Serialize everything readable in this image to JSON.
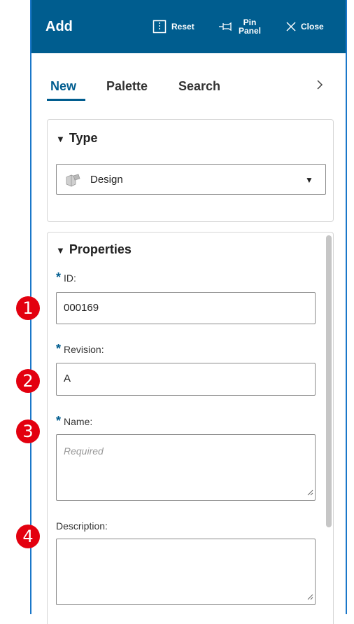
{
  "header": {
    "title": "Add",
    "reset_label": "Reset",
    "pin_label_line1": "Pin",
    "pin_label_line2": "Panel",
    "close_label": "Close",
    "background_color": "#005d8f"
  },
  "tabs": [
    {
      "label": "New",
      "active": true
    },
    {
      "label": "Palette",
      "active": false
    },
    {
      "label": "Search",
      "active": false
    }
  ],
  "tabs_more_icon": "chevron-right-icon",
  "type_section": {
    "heading": "Type",
    "selected_value": "Design",
    "icon": "design-item-icon"
  },
  "properties_section": {
    "heading": "Properties",
    "fields": [
      {
        "label": "ID:",
        "required": true,
        "value": "000169",
        "placeholder": ""
      },
      {
        "label": "Revision:",
        "required": true,
        "value": "A",
        "placeholder": ""
      },
      {
        "label": "Name:",
        "required": true,
        "value": "",
        "placeholder": "Required"
      },
      {
        "label": "Description:",
        "required": false,
        "value": "",
        "placeholder": ""
      }
    ]
  },
  "callouts": [
    "1",
    "2",
    "3",
    "4"
  ],
  "colors": {
    "accent": "#005d8f",
    "panel_border": "#1a77c9",
    "callout": "#e3000f"
  }
}
